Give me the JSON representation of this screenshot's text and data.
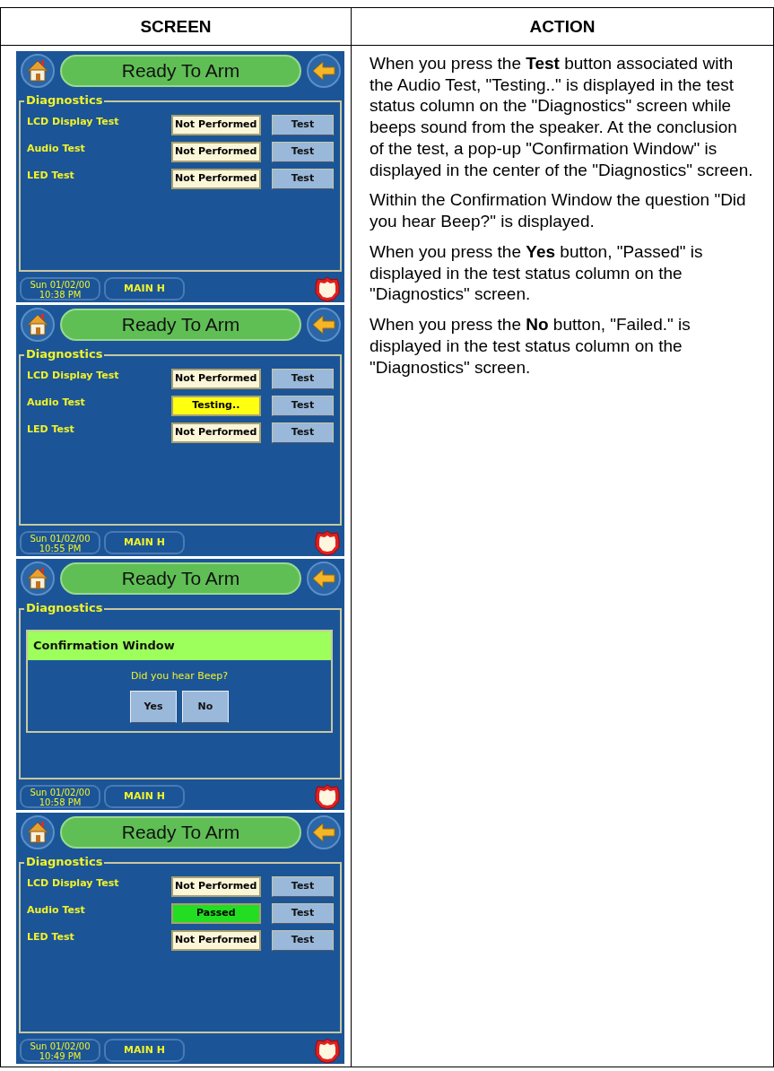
{
  "table": {
    "columns": [
      "SCREEN",
      "ACTION"
    ]
  },
  "screens": [
    {
      "status": "Ready To Arm",
      "panel_title": "Diagnostics",
      "tests": [
        {
          "name": "LCD Display Test",
          "result": "Not Performed",
          "kind": "idle",
          "button": "Test"
        },
        {
          "name": "Audio Test",
          "result": "Not Performed",
          "kind": "idle",
          "button": "Test"
        },
        {
          "name": "LED Test",
          "result": "Not Performed",
          "kind": "idle",
          "button": "Test"
        }
      ],
      "date": "Sun 01/02/00",
      "time": "10:38 PM",
      "partition": "MAIN H"
    },
    {
      "status": "Ready To Arm",
      "panel_title": "Diagnostics",
      "tests": [
        {
          "name": "LCD Display Test",
          "result": "Not Performed",
          "kind": "idle",
          "button": "Test"
        },
        {
          "name": "Audio Test",
          "result": "Testing..",
          "kind": "testing",
          "button": "Test"
        },
        {
          "name": "LED Test",
          "result": "Not Performed",
          "kind": "idle",
          "button": "Test"
        }
      ],
      "date": "Sun 01/02/00",
      "time": "10:55 PM",
      "partition": "MAIN H"
    },
    {
      "status": "Ready To Arm",
      "panel_title": "Diagnostics",
      "dialog": {
        "title": "Confirmation Window",
        "question": "Did you hear Beep?",
        "buttons": [
          "Yes",
          "No"
        ]
      },
      "date": "Sun 01/02/00",
      "time": "10:58 PM",
      "partition": "MAIN H"
    },
    {
      "status": "Ready To Arm",
      "panel_title": "Diagnostics",
      "tests": [
        {
          "name": "LCD Display Test",
          "result": "Not Performed",
          "kind": "idle",
          "button": "Test"
        },
        {
          "name": "Audio Test",
          "result": "Passed",
          "kind": "passed",
          "button": "Test"
        },
        {
          "name": "LED Test",
          "result": "Not Performed",
          "kind": "idle",
          "button": "Test"
        }
      ],
      "date": "Sun 01/02/00",
      "time": "10:49 PM",
      "partition": "MAIN H"
    }
  ],
  "action": {
    "paragraphs": [
      "When you press the **Test** button associated with the Audio Test, \"Testing..\" is displayed in the test status column on the \"Diagnostics\" screen while beeps sound from the speaker.  At the conclusion of the test, a pop-up \"Confirmation Window\" is displayed in the center of the \"Diagnostics\" screen.",
      "Within the Confirmation Window the question \"Did you hear Beep?\" is displayed.",
      "When you press the **Yes** button, \"Passed\" is displayed in the test status column on the \"Diagnostics\" screen.",
      "When you press the **No** button, \"Failed.\" is displayed in the test status column on the \"Diagnostics\" screen."
    ]
  }
}
